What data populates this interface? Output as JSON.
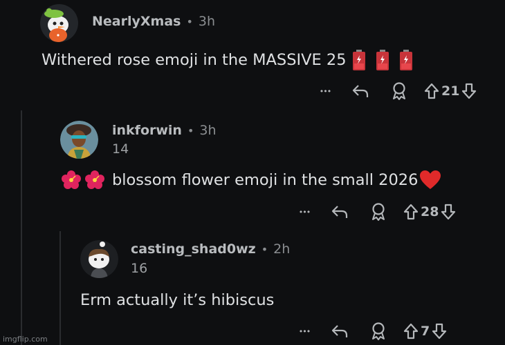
{
  "comments": [
    {
      "username": "NearlyXmas",
      "time": "3h",
      "flair": "",
      "text": "Withered rose emoji in the MASSIVE 25",
      "text_suffix_icons": [
        "battery-low-icon",
        "battery-low-icon",
        "battery-low-icon"
      ],
      "votes": "21"
    },
    {
      "username": "inkforwin",
      "time": "3h",
      "flair": "14",
      "text_prefix_icons": [
        "hibiscus-icon",
        "hibiscus-icon"
      ],
      "text": "blossom flower emoji in the small 2026",
      "text_suffix_icons": [
        "red-heart-icon"
      ],
      "votes": "28"
    },
    {
      "username": "casting_shad0wz",
      "time": "2h",
      "flair": "16",
      "text": "Erm actually it’s hibiscus",
      "votes": "7"
    }
  ],
  "separator": "•",
  "more_label": "•••",
  "watermark": "imgflip.com",
  "colors": {
    "background": "#0e0f11",
    "thread_line": "#2a2c2f",
    "battery_red": "#c8343a",
    "hibiscus": "#e0245e",
    "heart": "#e02a2a"
  }
}
